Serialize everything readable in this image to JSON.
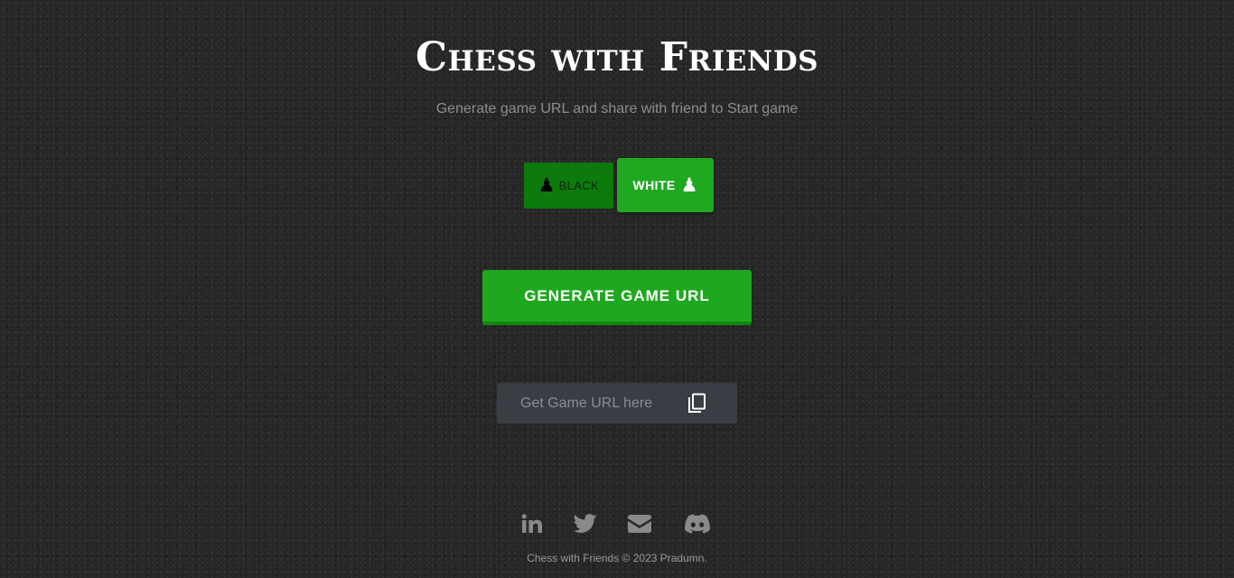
{
  "header": {
    "title": "Chess with Friends",
    "subtitle": "Generate game URL and share with friend to Start game"
  },
  "color_toggle": {
    "black_label": "BLACK",
    "white_label": "WHITE",
    "selected": "white",
    "black_icon": "black-pawn-icon",
    "white_icon": "white-pawn-icon"
  },
  "generate": {
    "label": "GENERATE GAME URL"
  },
  "url_field": {
    "placeholder": "Get Game URL here",
    "copy_icon": "copy-icon"
  },
  "socials": [
    {
      "icon": "linkedin-icon"
    },
    {
      "icon": "twitter-icon"
    },
    {
      "icon": "email-icon"
    },
    {
      "icon": "discord-icon"
    }
  ],
  "footer": {
    "text": "Chess with Friends © 2023 Pradumn."
  },
  "colors": {
    "background": "#262626",
    "accent_green": "#1fa81f",
    "dark_green": "#0d7a0d",
    "input_bg": "#3a3d44",
    "icon_gray": "#8a8a8a"
  }
}
